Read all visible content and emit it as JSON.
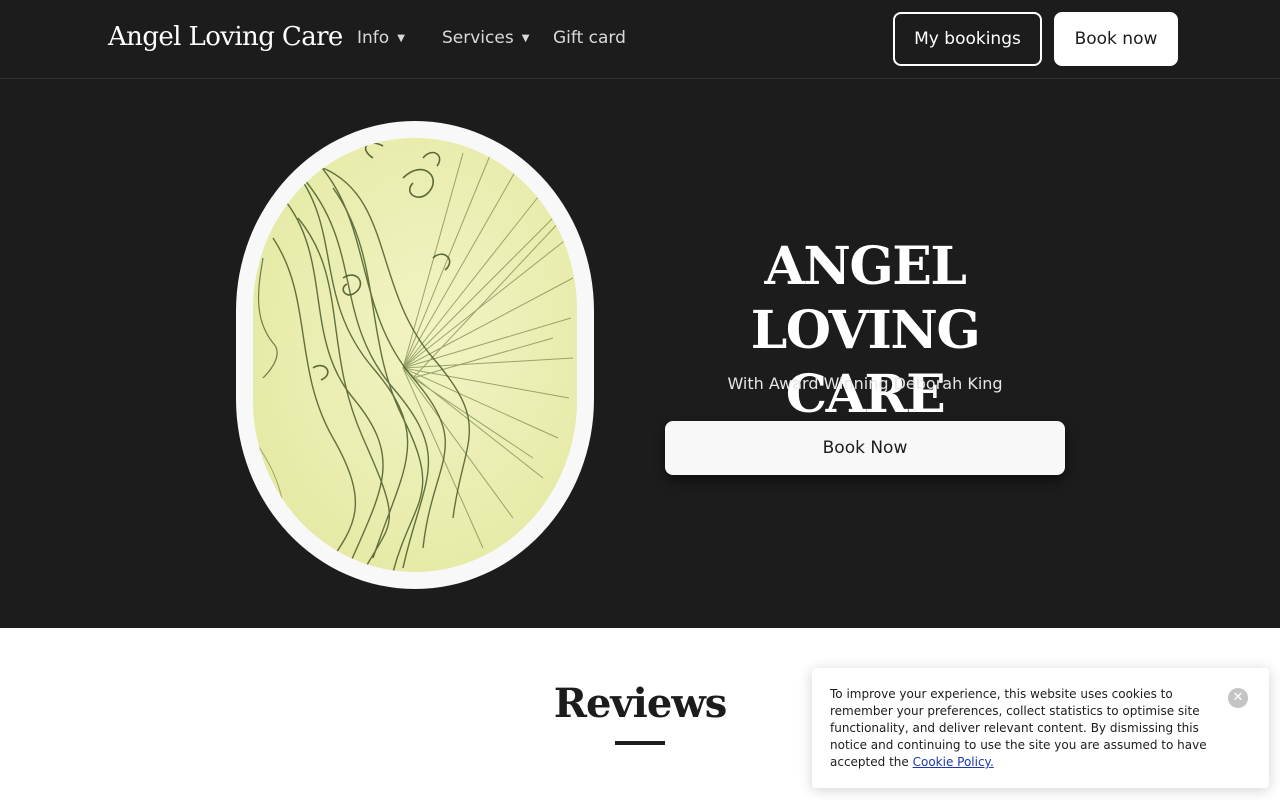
{
  "header": {
    "brand": "Angel Loving Care",
    "nav": {
      "info": "Info",
      "services": "Services",
      "gift_card": "Gift card"
    },
    "my_bookings": "My bookings",
    "book_now": "Book now"
  },
  "hero": {
    "title": "ANGEL LOVING CARE",
    "subtitle": "With Award Winning Deborah King",
    "cta": "Book Now",
    "image_icon": "fairy-sketch-image"
  },
  "reviews": {
    "title": "Reviews"
  },
  "cookie_banner": {
    "text": "To improve your experience, this website uses cookies to remember your preferences, collect statistics to optimise site functionality, and deliver relevant content. By dismissing this notice and continuing to use the site you are assumed to have accepted the",
    "link": "Cookie Policy.",
    "close_icon": "close-icon"
  },
  "colors": {
    "dark_bg": "#1c1c1c",
    "light": "#f8f8f8",
    "link": "#1a3aa8"
  }
}
